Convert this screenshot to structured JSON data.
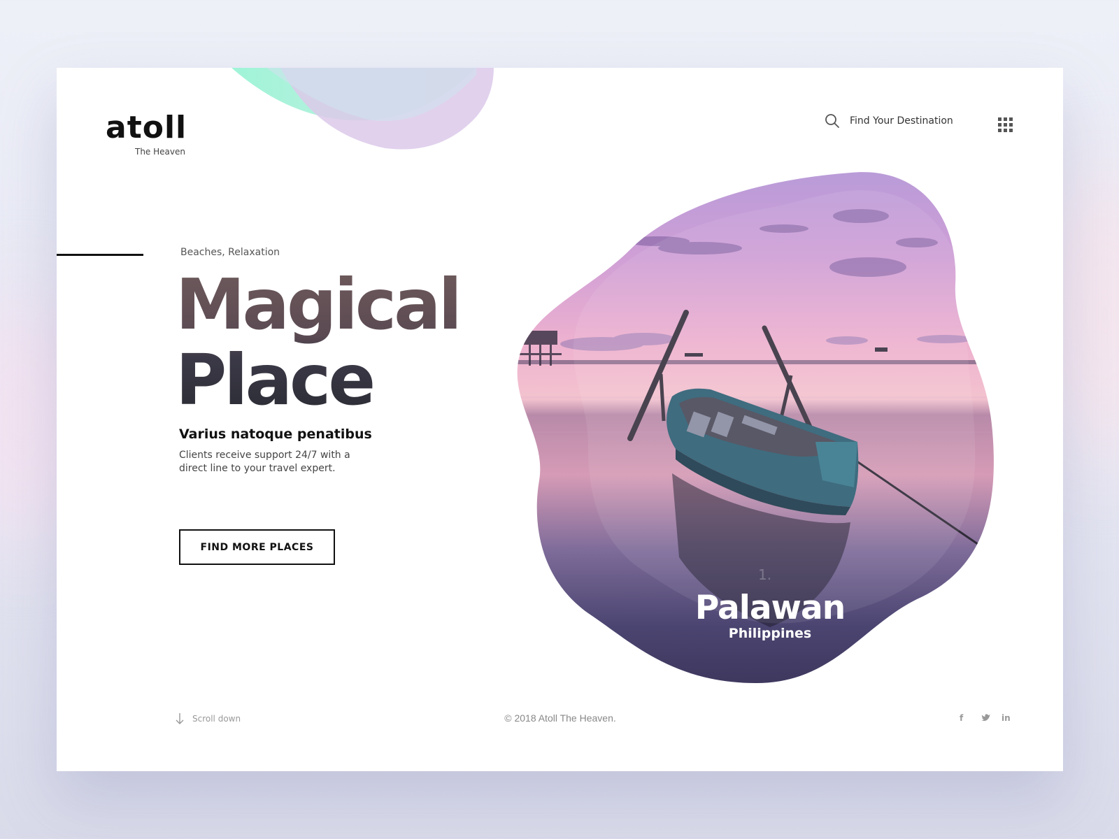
{
  "brand": {
    "name": "atoll",
    "tagline": "The Heaven"
  },
  "header": {
    "search_label": "Find Your Destination",
    "search_icon": "search-icon",
    "menu_icon": "grid-menu-icon"
  },
  "hero": {
    "tags": "Beaches, Relaxation",
    "headline_line1": "Magical",
    "headline_line2": "Place",
    "subheading": "Varius natoque penatibus",
    "description": "Clients receive support 24/7 with a direct line to your travel expert.",
    "cta_label": "FIND MORE PLACES"
  },
  "featured": {
    "index": "1.",
    "name": "Palawan",
    "country": "Philippines"
  },
  "footer": {
    "scroll_label": "Scroll down",
    "copyright": "© 2018 Atoll The Heaven.",
    "social": [
      {
        "icon": "facebook-icon",
        "glyph": "f"
      },
      {
        "icon": "twitter-icon",
        "glyph": "ᵛ"
      },
      {
        "icon": "linkedin-icon",
        "glyph": "in"
      }
    ]
  },
  "colors": {
    "accent_mint": "#9ff0d6",
    "accent_lilac": "#ddc9ec",
    "text_dark": "#111111",
    "sky_pink": "#e7a4c8",
    "water_purple": "#5a4f7e"
  }
}
